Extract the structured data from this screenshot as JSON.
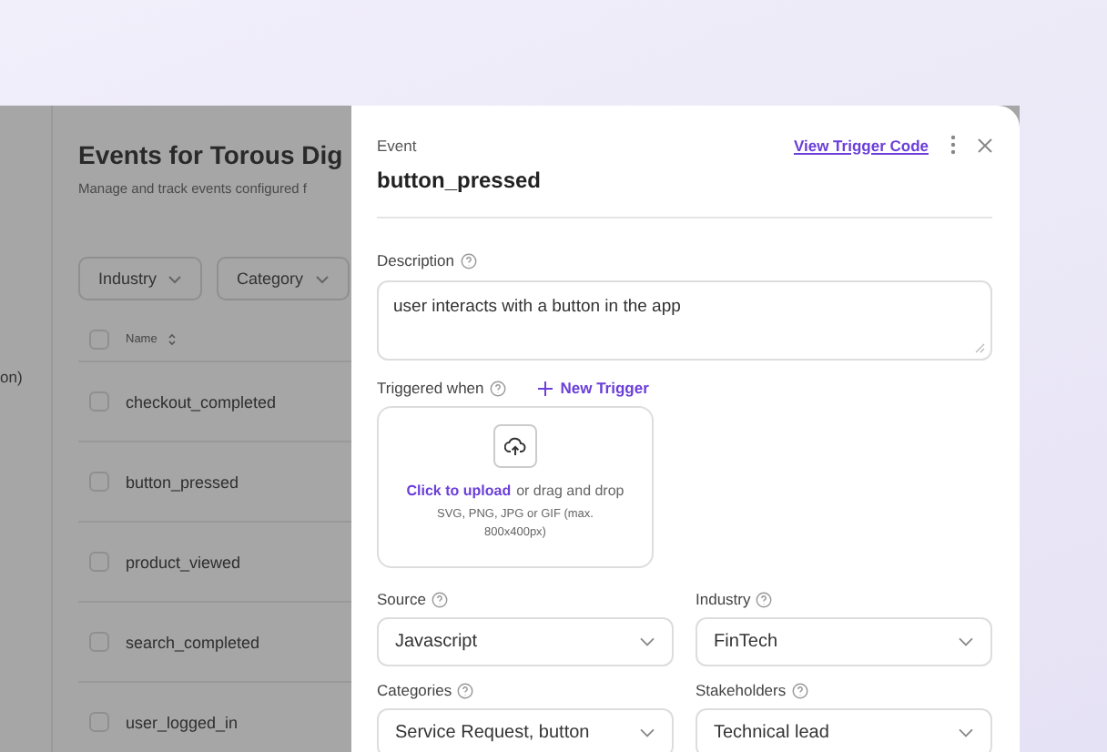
{
  "background_page": {
    "sidebar_text": "on)",
    "title": "Events for Torous Dig",
    "subtitle": "Manage and track events configured f",
    "filters": [
      "Industry",
      "Category"
    ],
    "table": {
      "columns": [
        "Name"
      ],
      "all_checked": false,
      "rows": [
        {
          "name": "checkout_completed",
          "checked": false
        },
        {
          "name": "button_pressed",
          "checked": false
        },
        {
          "name": "product_viewed",
          "checked": false
        },
        {
          "name": "search_completed",
          "checked": false
        },
        {
          "name": "user_logged_in",
          "checked": false
        }
      ]
    }
  },
  "event_panel": {
    "label": "Event",
    "title": "button_pressed",
    "link": "View Trigger Code",
    "description": {
      "label": "Description",
      "value": "user interacts with a button in the app"
    },
    "trigger": {
      "label": "Triggered when",
      "action": "New Trigger",
      "upload": {
        "link": "Click to upload",
        "text": "or drag and drop",
        "hint": "SVG, PNG, JPG or GIF (max. 800x400px)"
      }
    },
    "fields": [
      {
        "label": "Source",
        "value": "Javascript"
      },
      {
        "label": "Industry",
        "value": "FinTech"
      },
      {
        "label": "Categories",
        "value": "Service Request, button"
      },
      {
        "label": "Stakeholders",
        "value": "Technical lead"
      }
    ]
  }
}
